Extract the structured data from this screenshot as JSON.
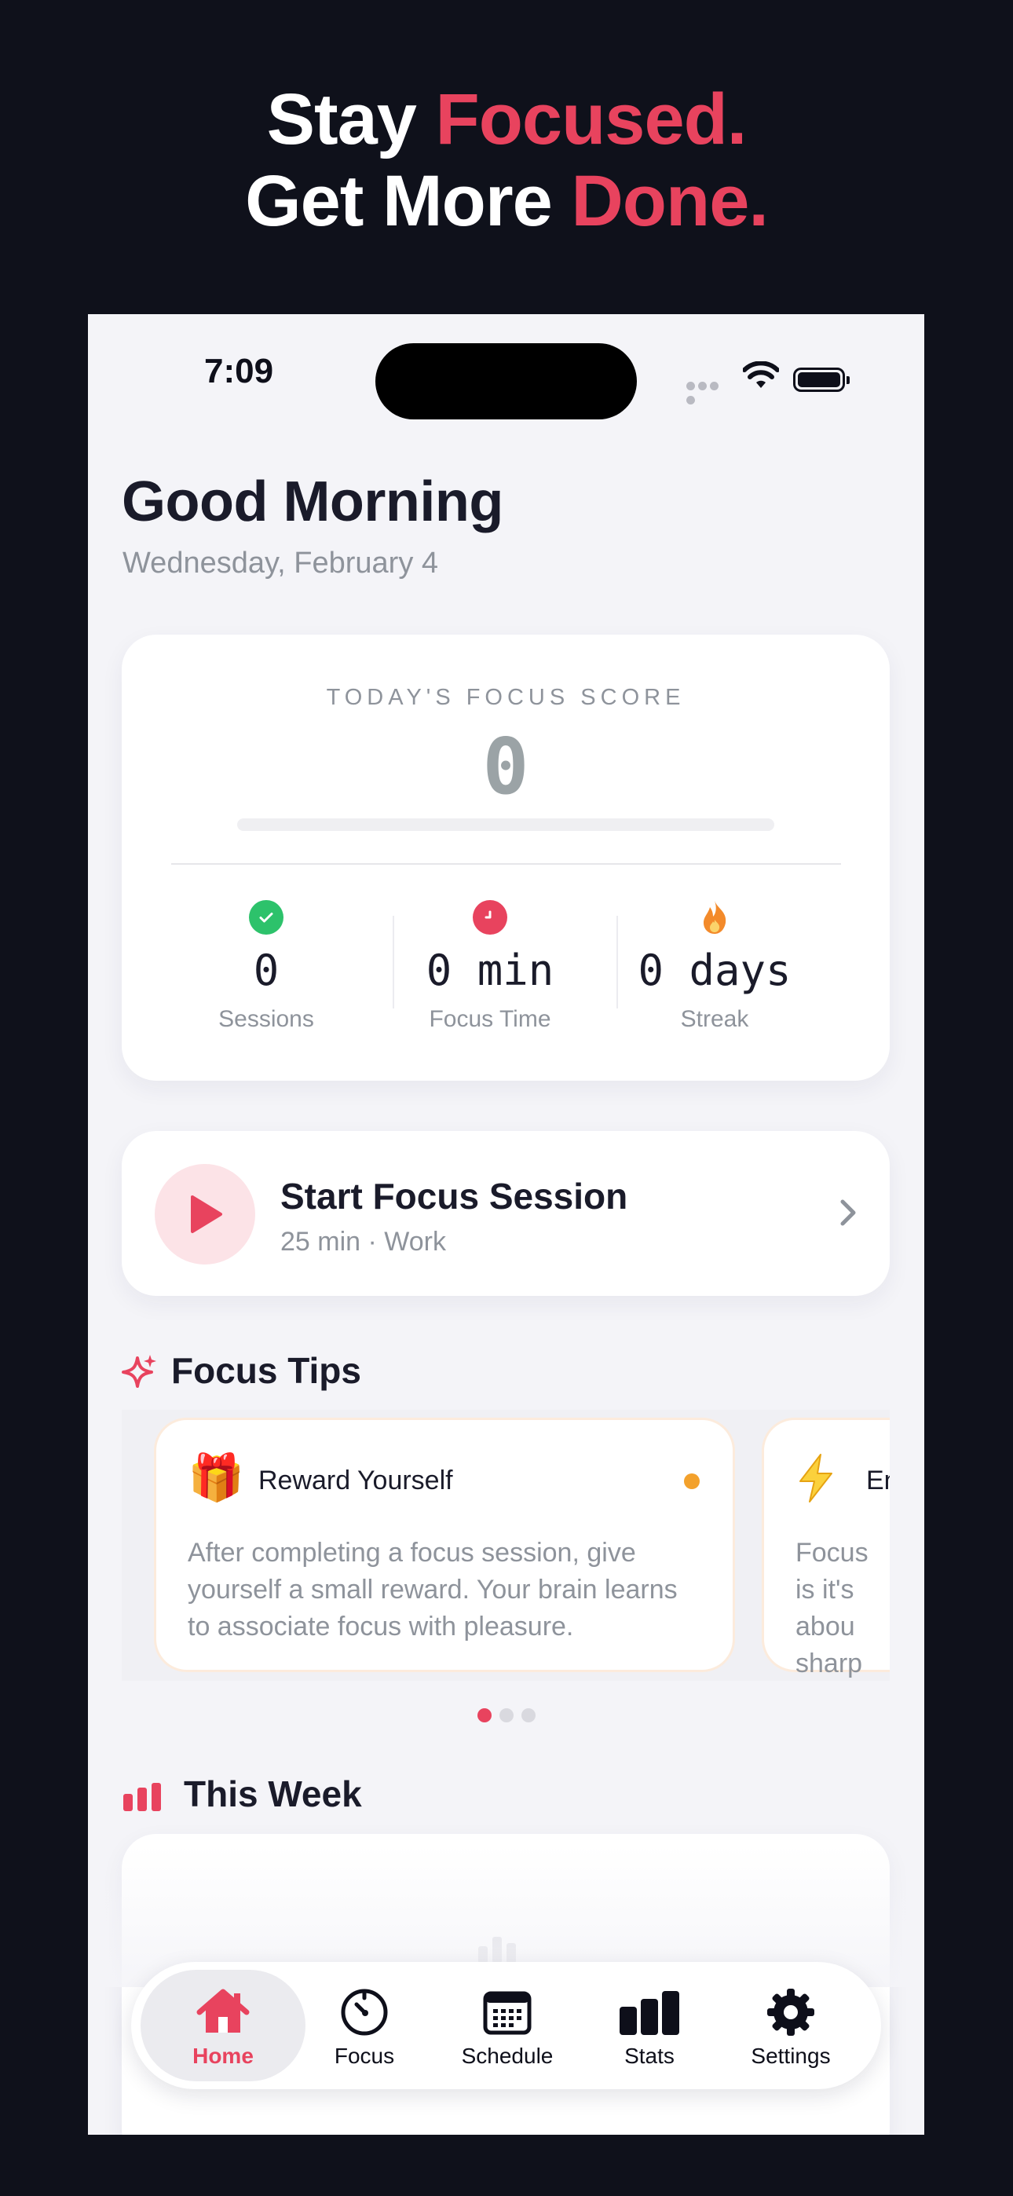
{
  "promo": {
    "line1_plain": "Stay ",
    "line1_accent": "Focused.",
    "line2_plain": "Get More ",
    "line2_accent": "Done."
  },
  "status_bar": {
    "time": "7:09"
  },
  "header": {
    "greeting": "Good Morning",
    "date": "Wednesday, February 4"
  },
  "focus_score": {
    "label": "TODAY'S FOCUS SCORE",
    "value": "0",
    "progress": 0,
    "stats": [
      {
        "icon": "check-circle-icon",
        "value": "0",
        "label": "Sessions"
      },
      {
        "icon": "clock-icon",
        "value": "0 min",
        "label": "Focus Time"
      },
      {
        "icon": "flame-icon",
        "value": "0 days",
        "label": "Streak"
      }
    ]
  },
  "start_session": {
    "title": "Start Focus Session",
    "subtitle": "25 min · Work"
  },
  "focus_tips": {
    "title": "Focus Tips",
    "tips": [
      {
        "icon": "gift-icon",
        "emoji": "🎁",
        "title": "Reward Yourself",
        "body": "After completing a focus session, give yourself a small reward. Your brain learns to associate focus with pleasure."
      },
      {
        "icon": "lightning-icon",
        "emoji": "⚡",
        "title": "En",
        "body": "Focus is it's abou sharp ar"
      }
    ],
    "page_count": 3,
    "active_page": 0
  },
  "this_week": {
    "title": "This Week"
  },
  "tab_bar": {
    "items": [
      {
        "label": "Home",
        "icon": "home-icon",
        "active": true
      },
      {
        "label": "Focus",
        "icon": "timer-icon",
        "active": false
      },
      {
        "label": "Schedule",
        "icon": "calendar-icon",
        "active": false
      },
      {
        "label": "Stats",
        "icon": "bar-chart-icon",
        "active": false
      },
      {
        "label": "Settings",
        "icon": "gear-icon",
        "active": false
      }
    ]
  },
  "colors": {
    "accent": "#E8435E",
    "background_dark": "#0F111B",
    "screen_background": "#F4F4F8",
    "success": "#2DC26B",
    "warning": "#F3A12C"
  }
}
